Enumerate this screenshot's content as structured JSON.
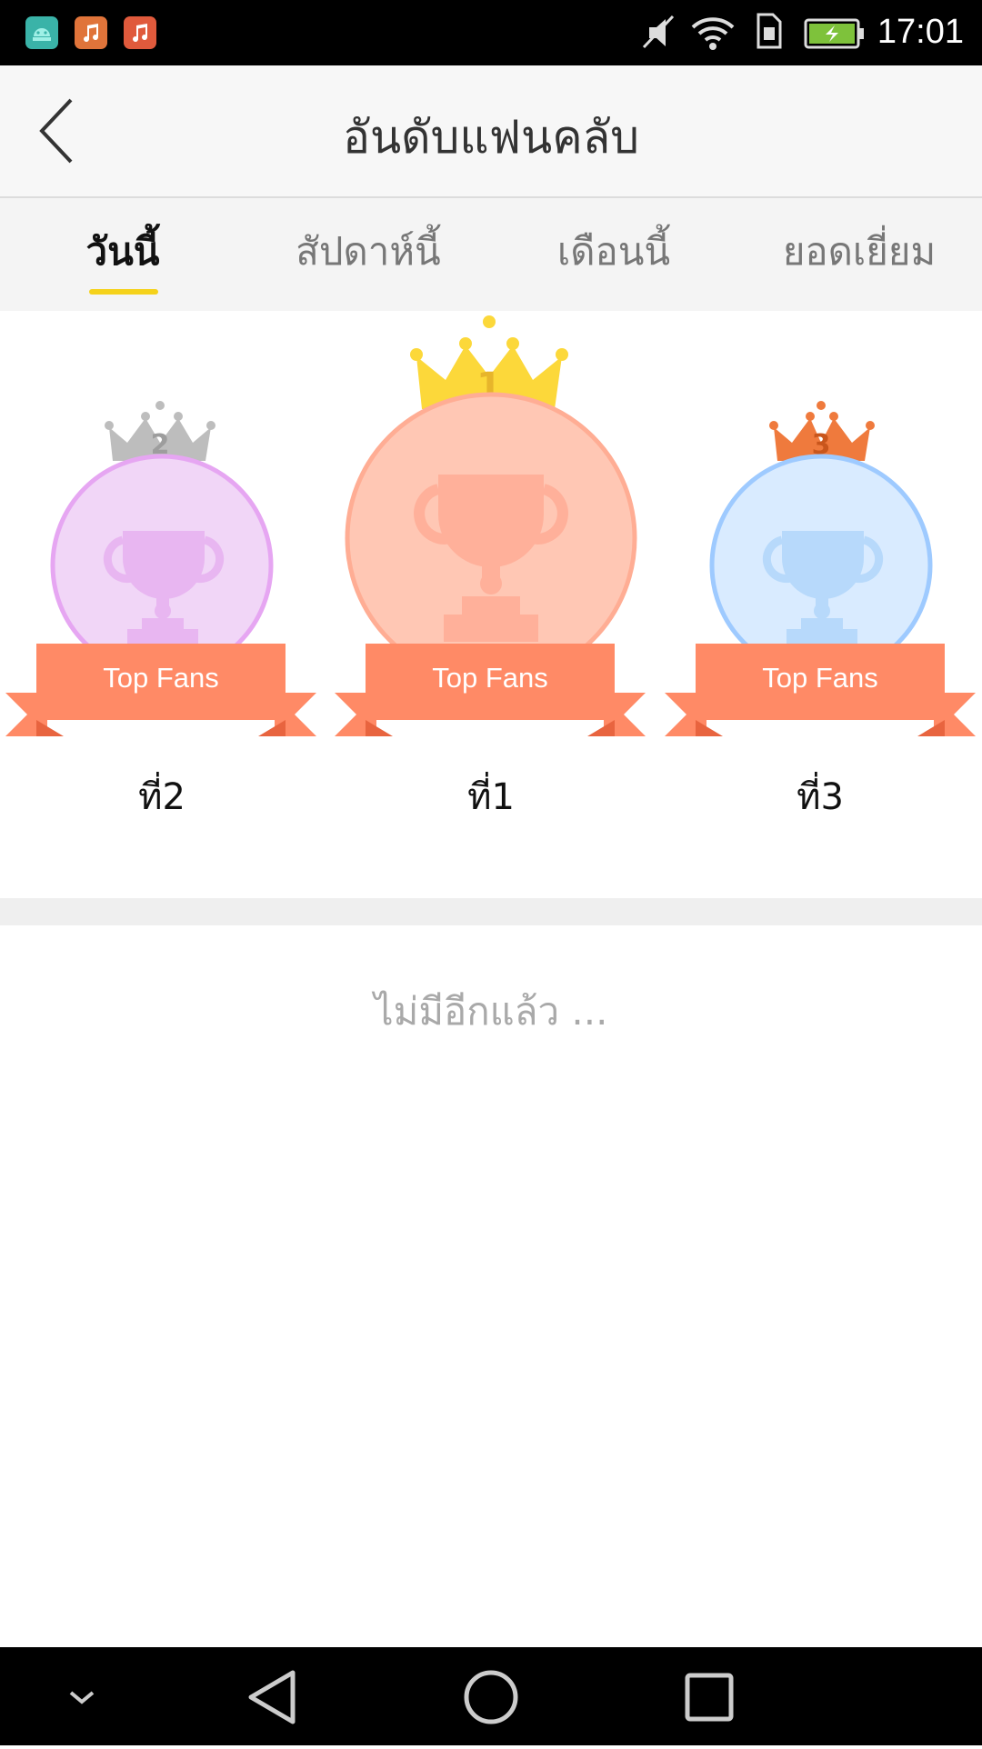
{
  "status_bar": {
    "time": "17:01",
    "app_icons": [
      "android-icon",
      "music-icon",
      "music-icon"
    ],
    "system_icons": [
      "mute-icon",
      "wifi-icon",
      "sim-icon",
      "battery-charging-icon"
    ]
  },
  "header": {
    "title": "อันดับแฟนคลับ",
    "back_icon": "chevron-left-icon"
  },
  "tabs": [
    {
      "label": "วันนี้",
      "active": true
    },
    {
      "label": "สัปดาห์นี้",
      "active": false
    },
    {
      "label": "เดือนนี้",
      "active": false
    },
    {
      "label": "ยอดเยี่ยม",
      "active": false
    }
  ],
  "podium": [
    {
      "position": 2,
      "crown_number": "2",
      "ribbon": "Top Fans",
      "rank_label": "ที่2",
      "circle_color": "#f1d6f7",
      "ring_color": "#e6a6f2",
      "crown_color": "#bdbdbd"
    },
    {
      "position": 1,
      "crown_number": "1",
      "ribbon": "Top Fans",
      "rank_label": "ที่1",
      "circle_color": "#ffc7b4",
      "ring_color": "#ffad94",
      "crown_color": "#fcd83a"
    },
    {
      "position": 3,
      "crown_number": "3",
      "ribbon": "Top Fans",
      "rank_label": "ที่3",
      "circle_color": "#d9ebff",
      "ring_color": "#9ecaff",
      "crown_color": "#ef7a3d"
    }
  ],
  "empty_text": "ไม่มีอีกแล้ว ...",
  "colors": {
    "accent": "#f5d21b",
    "ribbon": "#ff8a66",
    "ribbon_dark": "#e8643f"
  },
  "nav_bar": [
    "chevron-down-icon",
    "back-triangle-icon",
    "home-circle-icon",
    "recents-square-icon"
  ]
}
